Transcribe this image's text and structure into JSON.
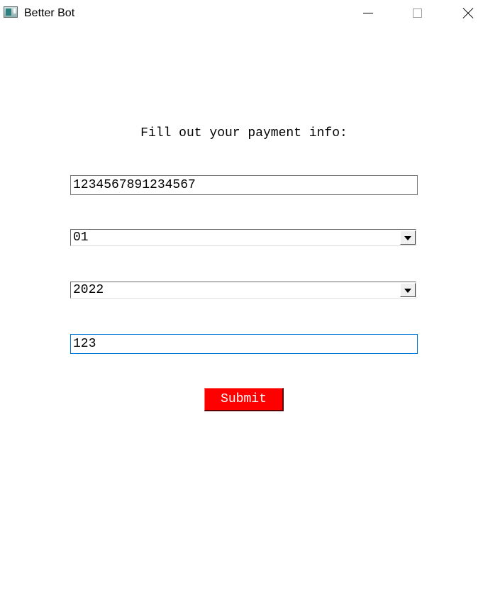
{
  "window": {
    "title": "Better Bot",
    "icon": "app-window-icon",
    "controls": [
      "minimize-icon",
      "maximize-icon",
      "close-icon"
    ]
  },
  "form": {
    "heading": "Fill out your payment info:",
    "card_number": "1234567891234567",
    "expiry_month": "01",
    "expiry_year": "2022",
    "cvv": "123",
    "submit_label": "Submit"
  },
  "colors": {
    "submit_background": "#ff0000",
    "submit_text": "#ffffff",
    "focused_border": "#0078d7"
  }
}
